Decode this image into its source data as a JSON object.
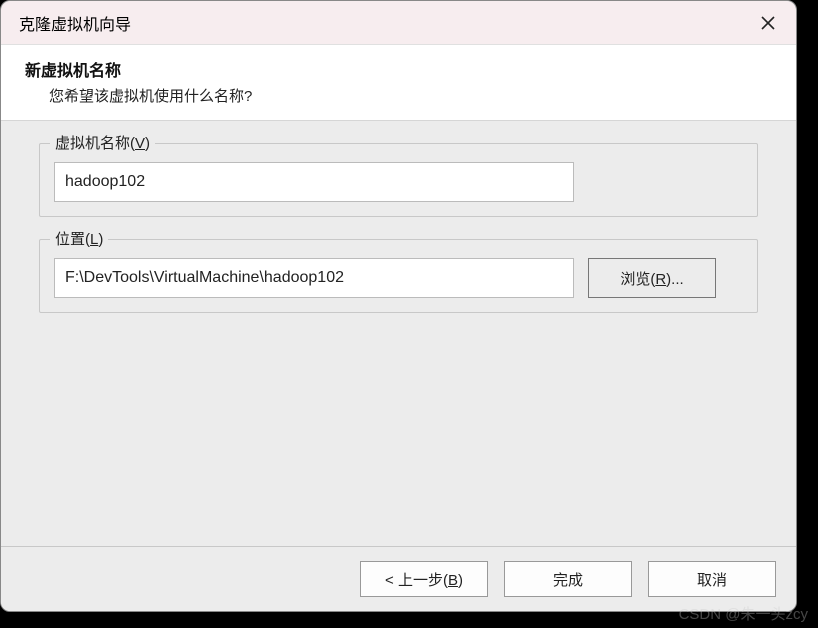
{
  "titlebar": {
    "title": "克隆虚拟机向导"
  },
  "header": {
    "heading": "新虚拟机名称",
    "subheading": "您希望该虚拟机使用什么名称?"
  },
  "form": {
    "name_group": {
      "label_prefix": "虚拟机名称(",
      "label_key": "V",
      "label_suffix": ")",
      "value": "hadoop102"
    },
    "location_group": {
      "label_prefix": "位置(",
      "label_key": "L",
      "label_suffix": ")",
      "value": "F:\\DevTools\\VirtualMachine\\hadoop102",
      "browse_prefix": "浏览(",
      "browse_key": "R",
      "browse_suffix": ")..."
    }
  },
  "footer": {
    "back_prefix": "< 上一步(",
    "back_key": "B",
    "back_suffix": ")",
    "finish": "完成",
    "cancel": "取消"
  },
  "watermark": "CSDN @朱一头zcy"
}
